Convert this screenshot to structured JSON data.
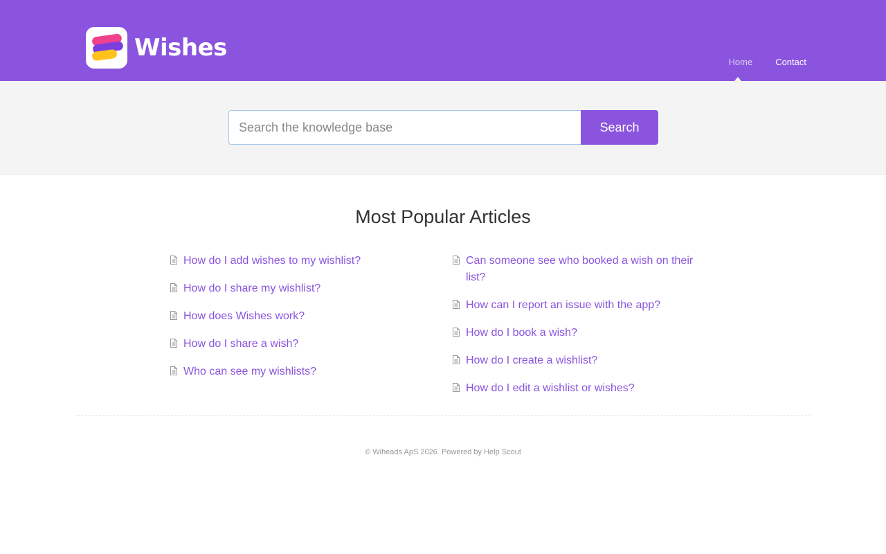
{
  "header": {
    "brand": "Wishes",
    "nav": [
      {
        "label": "Home",
        "active": true
      },
      {
        "label": "Contact",
        "active": false
      }
    ],
    "background_color": "#8a54de"
  },
  "search": {
    "placeholder": "Search the knowledge base",
    "value": "",
    "button_label": "Search"
  },
  "popular": {
    "title": "Most Popular Articles",
    "left_articles": [
      "How do I add wishes to my wishlist?",
      "How do I share my wishlist?",
      "How does Wishes work?",
      "How do I share a wish?",
      "Who can see my wishlists?"
    ],
    "right_articles": [
      "Can someone see who booked a wish on their list?",
      "How can I report an issue with the app?",
      "How do I book a wish?",
      "How do I create a wishlist?",
      "How do I edit a wishlist or wishes?"
    ],
    "icon": "document-icon"
  },
  "footer": {
    "copyright": "© Wiheads ApS 2026.",
    "powered_prefix": "Powered by",
    "powered_link": "Help Scout"
  },
  "colors": {
    "accent": "#8a54de",
    "link": "#8a54de"
  }
}
